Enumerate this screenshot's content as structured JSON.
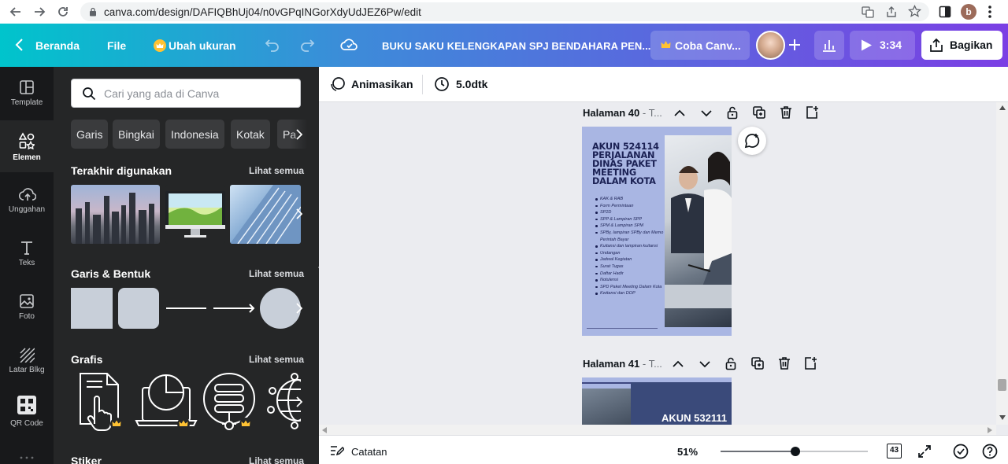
{
  "browser": {
    "url": "canva.com/design/DAFIQBhUj04/n0vGPqINGorXdyUdJEZ6Pw/edit",
    "profile_initial": "b"
  },
  "header": {
    "home": "Beranda",
    "file": "File",
    "resize": "Ubah ukuran",
    "title": "BUKU SAKU KELENGKAPAN SPJ BENDAHARA PEN...",
    "try_pro": "Coba Canv...",
    "duration": "3:34",
    "share": "Bagikan"
  },
  "rail": [
    {
      "label": "Template",
      "icon": "template-icon"
    },
    {
      "label": "Elemen",
      "icon": "elements-icon"
    },
    {
      "label": "Unggahan",
      "icon": "upload-icon"
    },
    {
      "label": "Teks",
      "icon": "text-icon"
    },
    {
      "label": "Foto",
      "icon": "photo-icon"
    },
    {
      "label": "Latar Blkg",
      "icon": "background-icon"
    },
    {
      "label": "QR Code",
      "icon": "qr-code-icon"
    }
  ],
  "panel": {
    "search_placeholder": "Cari yang ada di Canva",
    "chips": [
      "Garis",
      "Bingkai",
      "Indonesia",
      "Kotak",
      "Pa"
    ],
    "sections": {
      "recent": "Terakhir digunakan",
      "shapes": "Garis & Bentuk",
      "graphics": "Grafis",
      "stickers": "Stiker"
    },
    "see_all": "Lihat semua"
  },
  "toolbar": {
    "animate": "Animasikan",
    "timing": "5.0dtk"
  },
  "pages": {
    "p40_label_num": "Halaman 40",
    "p40_label_rest": " - T...",
    "p41_label_num": "Halaman 41",
    "p41_label_rest": " - T...",
    "p40_title": "AKUN 524114 PERJALANAN DINAS PAKET MEETING DALAM KOTA",
    "p40_items": [
      "KAK & RAB",
      "Form Permintaan",
      "SP2D",
      "SPP & Lampiran SPP",
      "SPM & Lampiran SPM",
      "SPBy, lampiran SPBy dan Memo Perintah Bayar",
      "Kuitansi dan lampiran kuitansi",
      "Undangan",
      "Jadwal Kegiatan",
      "Surat Tugas",
      "Daftar Hadir",
      "Notulensi",
      "SPD Paket Meeting Dalam Kota",
      "Kwitansi dan DOP"
    ],
    "p41_title": "AKUN 532111"
  },
  "bottom": {
    "notes": "Catatan",
    "zoom": "51%",
    "page_count": "43",
    "zoom_fraction": 0.51
  },
  "colors": {
    "header_start": "#00c4cc",
    "header_end": "#7b3fe4",
    "panel_bg": "#252627",
    "page_bg": "#a9b6e3",
    "page_text": "#1b2154"
  }
}
